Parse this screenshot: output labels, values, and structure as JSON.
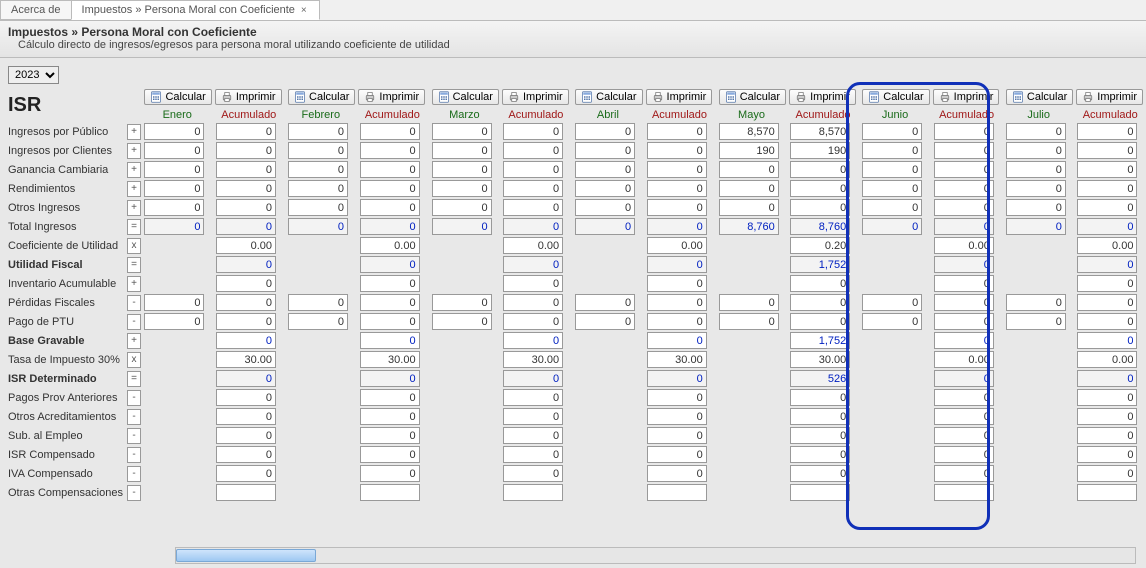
{
  "tabs": {
    "inactive": "Acerca de",
    "active": "Impuestos » Persona Moral con Coeficiente"
  },
  "header": {
    "title": "Impuestos » Persona Moral con Coeficiente",
    "subtitle": "Cálculo directo de ingresos/egresos para persona moral utilizando coeficiente de utilidad"
  },
  "year": "2023",
  "section": "ISR",
  "btn": {
    "calc": "Calcular",
    "print": "Imprimir"
  },
  "months": [
    "Enero",
    "Febrero",
    "Marzo",
    "Abril",
    "Mayo",
    "Junio",
    "Julio"
  ],
  "acum_label": "Acumulado",
  "rows": [
    {
      "label": "Ingresos por Público",
      "op": "+",
      "bold": false,
      "m": [
        "0",
        "0",
        "0",
        "0",
        "8,570",
        "0",
        "0"
      ],
      "a": [
        "0",
        "0",
        "0",
        "0",
        "8,570",
        "0",
        "0"
      ]
    },
    {
      "label": "Ingresos por Clientes",
      "op": "+",
      "bold": false,
      "m": [
        "0",
        "0",
        "0",
        "0",
        "190",
        "0",
        "0"
      ],
      "a": [
        "0",
        "0",
        "0",
        "0",
        "190",
        "0",
        "0"
      ]
    },
    {
      "label": "Ganancia Cambiaria",
      "op": "+",
      "bold": false,
      "m": [
        "0",
        "0",
        "0",
        "0",
        "0",
        "0",
        "0"
      ],
      "a": [
        "0",
        "0",
        "0",
        "0",
        "0",
        "0",
        "0"
      ]
    },
    {
      "label": "Rendimientos",
      "op": "+",
      "bold": false,
      "m": [
        "0",
        "0",
        "0",
        "0",
        "0",
        "0",
        "0"
      ],
      "a": [
        "0",
        "0",
        "0",
        "0",
        "0",
        "0",
        "0"
      ]
    },
    {
      "label": "Otros Ingresos",
      "op": "+",
      "bold": false,
      "m": [
        "0",
        "0",
        "0",
        "0",
        "0",
        "0",
        "0"
      ],
      "a": [
        "0",
        "0",
        "0",
        "0",
        "0",
        "0",
        "0"
      ]
    },
    {
      "label": "Total Ingresos",
      "op": "=",
      "bold": false,
      "blue": true,
      "m": [
        "0",
        "0",
        "0",
        "0",
        "8,760",
        "0",
        "0"
      ],
      "a": [
        "0",
        "0",
        "0",
        "0",
        "8,760",
        "0",
        "0"
      ]
    },
    {
      "label": "Coeficiente de Utilidad",
      "op": "x",
      "bold": false,
      "single": true,
      "a": [
        "0.00",
        "0.00",
        "0.00",
        "0.00",
        "0.20",
        "0.00",
        "0.00"
      ]
    },
    {
      "label": "Utilidad Fiscal",
      "op": "=",
      "bold": true,
      "blue": true,
      "single": true,
      "a": [
        "0",
        "0",
        "0",
        "0",
        "1,752",
        "0",
        "0"
      ]
    },
    {
      "label": "Inventario Acumulable",
      "op": "+",
      "bold": false,
      "single": true,
      "a": [
        "0",
        "0",
        "0",
        "0",
        "0",
        "0",
        "0"
      ]
    },
    {
      "label": "Pérdidas Fiscales",
      "op": "-",
      "bold": false,
      "m": [
        "0",
        "0",
        "0",
        "0",
        "0",
        "0",
        "0"
      ],
      "a": [
        "0",
        "0",
        "0",
        "0",
        "0",
        "0",
        "0"
      ]
    },
    {
      "label": "Pago de PTU",
      "op": "-",
      "bold": false,
      "m": [
        "0",
        "0",
        "0",
        "0",
        "0",
        "0",
        "0"
      ],
      "a": [
        "0",
        "0",
        "0",
        "0",
        "0",
        "0",
        "0"
      ]
    },
    {
      "label": "Base Gravable",
      "op": "+",
      "bold": true,
      "blue": true,
      "single": true,
      "a": [
        "0",
        "0",
        "0",
        "0",
        "1,752",
        "0",
        "0"
      ]
    },
    {
      "label": "Tasa de Impuesto 30%",
      "op": "x",
      "bold": false,
      "single": true,
      "a": [
        "30.00",
        "30.00",
        "30.00",
        "30.00",
        "30.00",
        "0.00",
        "0.00"
      ]
    },
    {
      "label": "ISR Determinado",
      "op": "=",
      "bold": true,
      "blue": true,
      "single": true,
      "a": [
        "0",
        "0",
        "0",
        "0",
        "526",
        "0",
        "0"
      ]
    },
    {
      "label": "Pagos Prov Anteriores",
      "op": "-",
      "bold": false,
      "single": true,
      "a": [
        "0",
        "0",
        "0",
        "0",
        "0",
        "0",
        "0"
      ]
    },
    {
      "label": "Otros Acreditamientos",
      "op": "-",
      "bold": false,
      "single": true,
      "a": [
        "0",
        "0",
        "0",
        "0",
        "0",
        "0",
        "0"
      ]
    },
    {
      "label": "Sub. al Empleo",
      "op": "-",
      "bold": false,
      "single": true,
      "a": [
        "0",
        "0",
        "0",
        "0",
        "0",
        "0",
        "0"
      ]
    },
    {
      "label": "ISR Compensado",
      "op": "-",
      "bold": false,
      "single": true,
      "a": [
        "0",
        "0",
        "0",
        "0",
        "0",
        "0",
        "0"
      ]
    },
    {
      "label": "IVA Compensado",
      "op": "-",
      "bold": false,
      "single": true,
      "a": [
        "0",
        "0",
        "0",
        "0",
        "0",
        "0",
        "0"
      ]
    },
    {
      "label": "Otras Compensaciones",
      "op": "-",
      "bold": false,
      "single": true,
      "a": [
        "",
        "",
        "",
        "",
        "",
        "",
        ""
      ]
    }
  ],
  "highlight_col_index": 4
}
